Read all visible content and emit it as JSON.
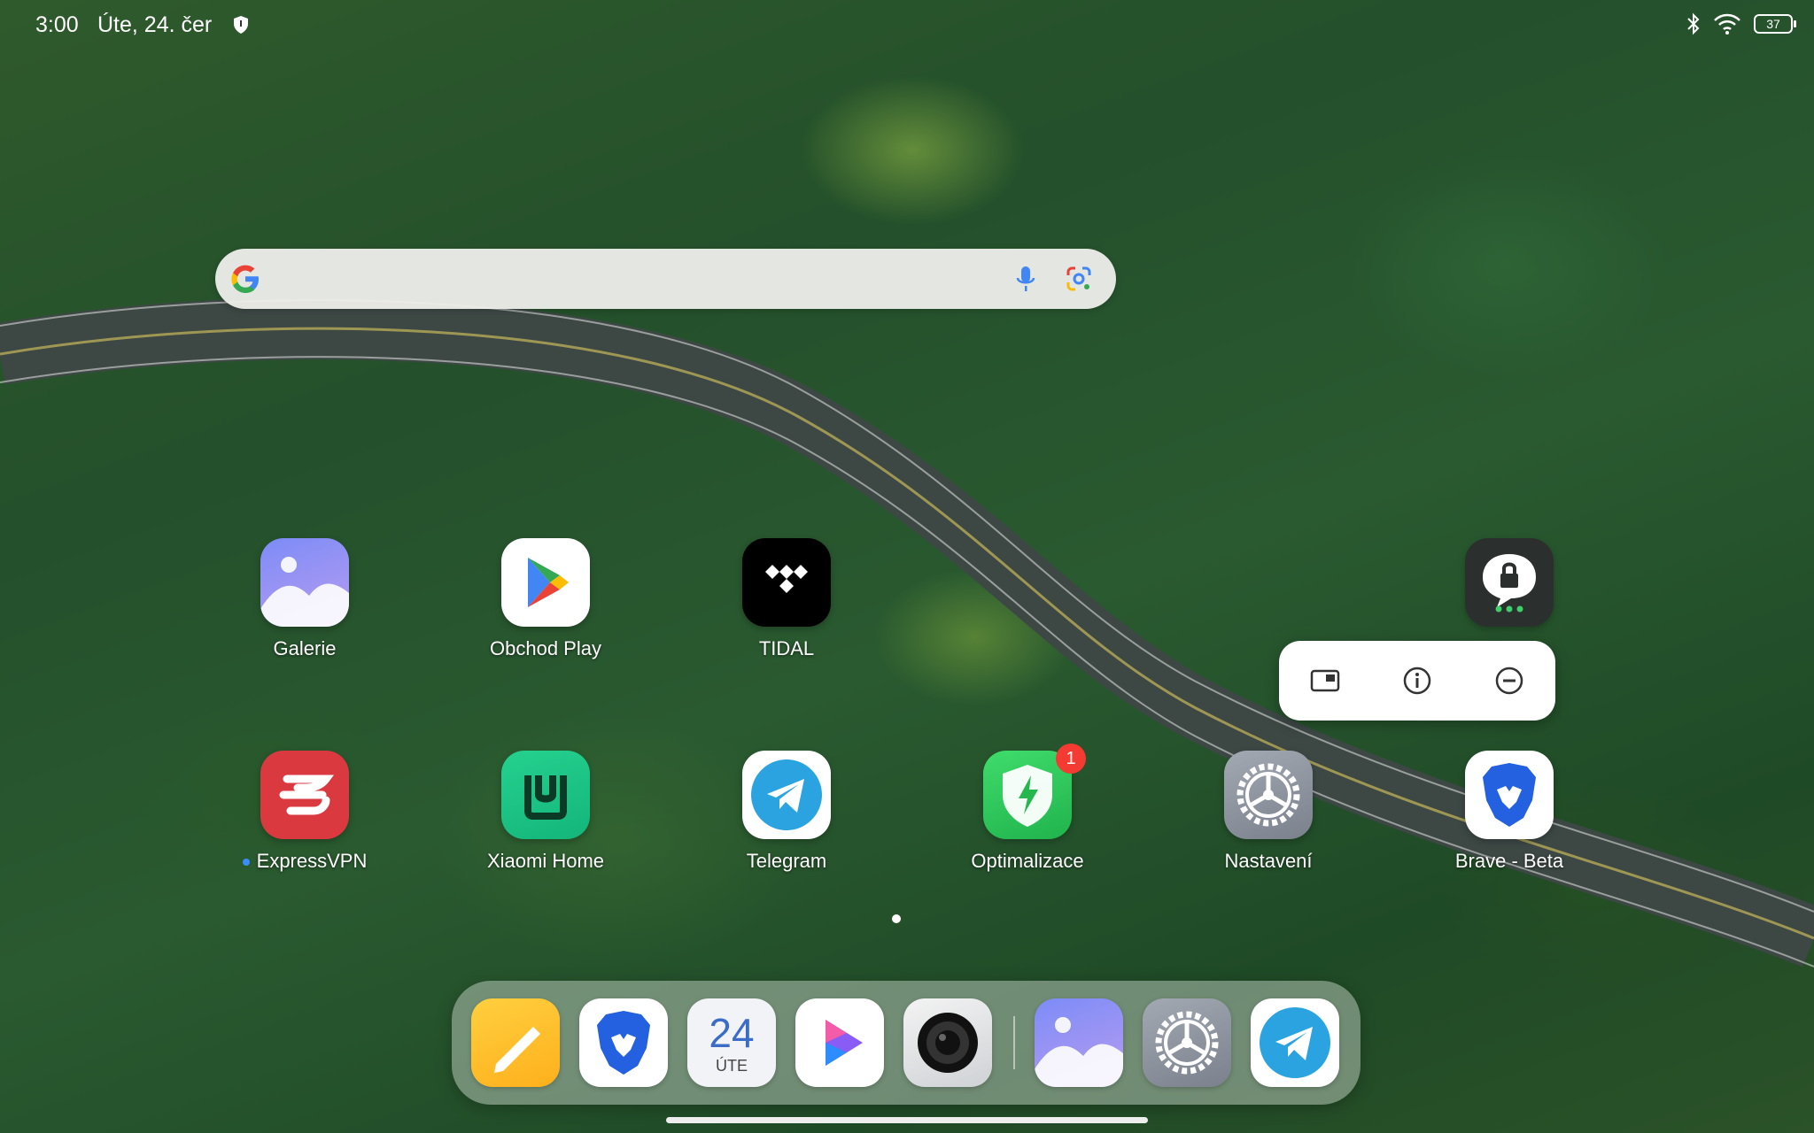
{
  "status": {
    "time": "3:00",
    "date": "Úte, 24. čer",
    "battery": "37"
  },
  "search": {
    "placeholder": ""
  },
  "apps_row1": [
    {
      "label": "Galerie",
      "icon": "gallery-icon"
    },
    {
      "label": "Obchod Play",
      "icon": "play-store-icon"
    },
    {
      "label": "TIDAL",
      "icon": "tidal-icon"
    },
    {
      "label": "",
      "icon": "app-lock-icon"
    }
  ],
  "apps_row2": [
    {
      "label": "ExpressVPN",
      "icon": "expressvpn-icon"
    },
    {
      "label": "Xiaomi Home",
      "icon": "xiaomi-home-icon"
    },
    {
      "label": "Telegram",
      "icon": "telegram-icon"
    },
    {
      "label": "Optimalizace",
      "icon": "security-shield-icon",
      "badge": "1"
    },
    {
      "label": "Nastavení",
      "icon": "settings-gear-icon"
    },
    {
      "label": "Brave - Beta",
      "icon": "brave-lion-icon"
    }
  ],
  "popup": {
    "actions": [
      "widget-icon",
      "info-icon",
      "remove-icon"
    ]
  },
  "dock": {
    "calendar_day": "24",
    "calendar_weekday": "ÚTE",
    "items": [
      "notes-icon",
      "brave-lion-icon",
      "calendar-icon",
      "video-player-icon",
      "camera-icon",
      "gallery-icon",
      "settings-gear-icon",
      "telegram-icon"
    ]
  },
  "colors": {
    "accent_blue": "#3b8cff",
    "badge_red": "#f33a33"
  }
}
